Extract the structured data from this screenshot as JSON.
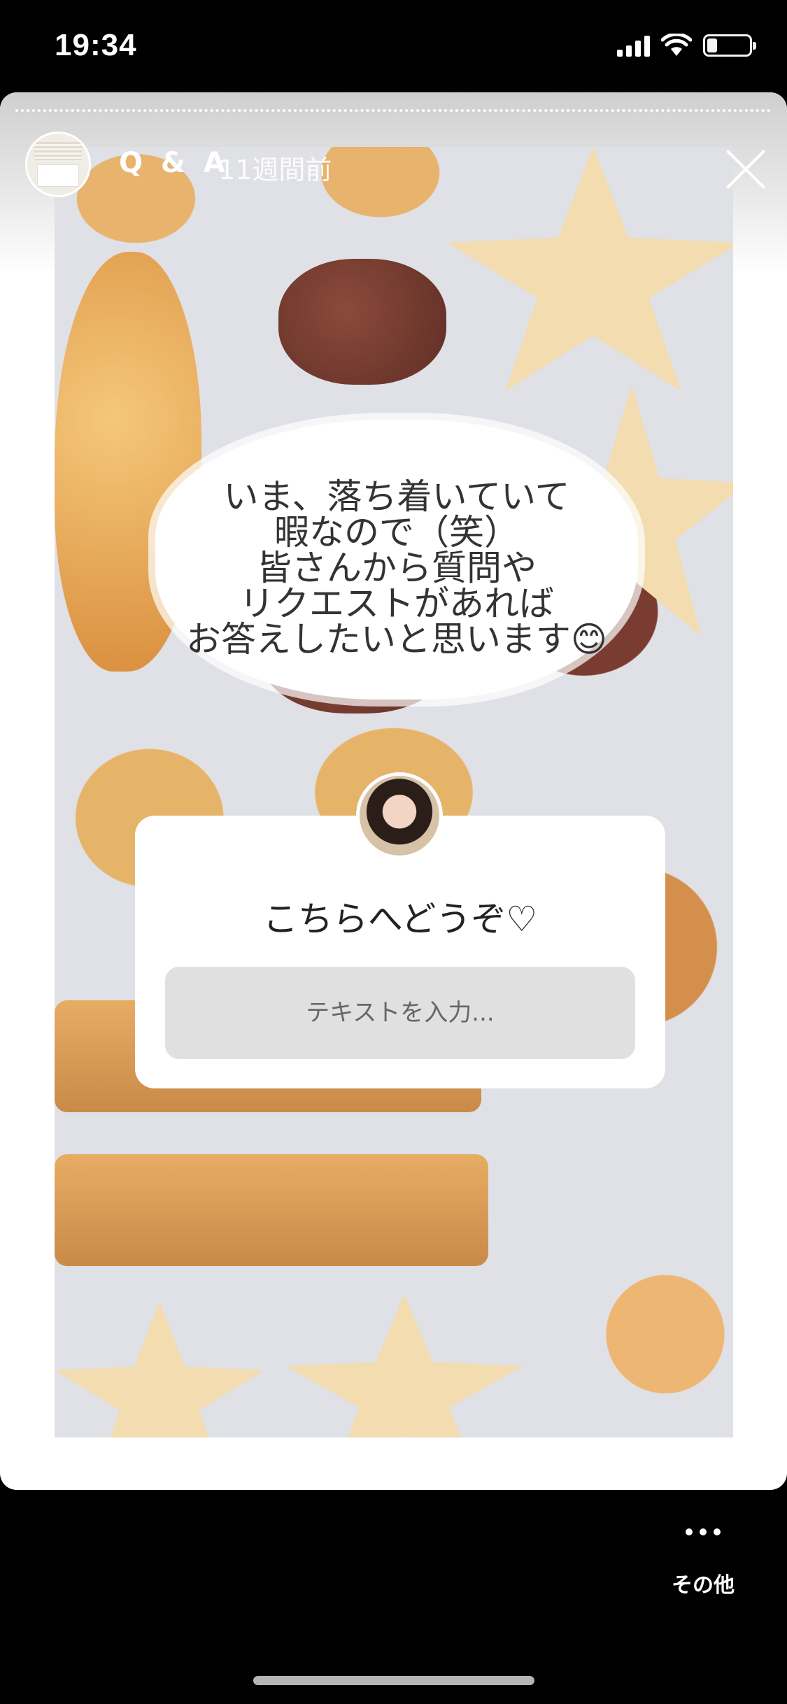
{
  "status_bar": {
    "time": "19:34"
  },
  "story_header": {
    "title": "Q & A",
    "time_ago": "11週間前"
  },
  "bubble_lines": [
    "いま、落ち着いていて",
    "暇なので（笑）",
    "皆さんから質問や",
    "リクエストがあれば",
    "お答えしたいと思います😊"
  ],
  "question_sticker": {
    "prompt": "こちらへどうぞ♡",
    "input_placeholder": "テキストを入力..."
  },
  "footer": {
    "more_label": "その他"
  },
  "colors": {
    "background": "#000000",
    "card": "#ffffff",
    "input_bg": "#e0e0e0"
  }
}
